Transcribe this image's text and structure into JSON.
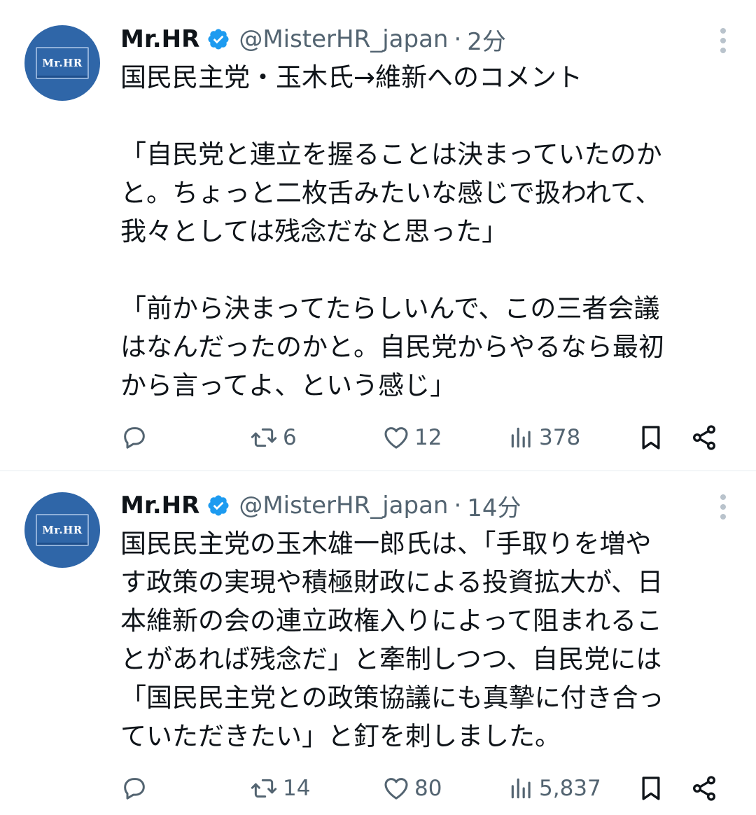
{
  "tweets": [
    {
      "author_name": "Mr.HR",
      "avatar_text": "Mr.HR",
      "handle": "@MisterHR_japan",
      "separator": "·",
      "time": "2分",
      "lines": [
        "国民民主党・玉木氏→維新へのコメント",
        "",
        "「自民党と連立を握ることは決まっていたのか",
        "と。ちょっと二枚舌みたいな感じで扱われて、",
        "我々としては残念だなと思った」",
        "",
        "「前から決まってたらしいんで、この三者会議",
        "はなんだったのかと。自民党からやるなら最初",
        "から言ってよ、という感じ」"
      ],
      "retweets": "6",
      "likes": "12",
      "views": "378"
    },
    {
      "author_name": "Mr.HR",
      "avatar_text": "Mr.HR",
      "handle": "@MisterHR_japan",
      "separator": "·",
      "time": "14分",
      "lines": [
        "国民民主党の玉木雄一郎氏は、「手取りを増や",
        "す政策の実現や積極財政による投資拡大が、日",
        "本維新の会の連立政権入りによって阻まれるこ",
        "とがあれば残念だ」と牽制しつつ、自民党には",
        "「国民民主党との政策協議にも真摯に付き合っ",
        "ていただきたい」と釘を刺しました。"
      ],
      "retweets": "14",
      "likes": "80",
      "views": "5,837"
    }
  ],
  "icons": {
    "verified": "verified-badge-icon",
    "more": "more-vertical-icon",
    "reply": "reply-icon",
    "retweet": "retweet-icon",
    "like": "heart-icon",
    "views": "views-icon",
    "bookmark": "bookmark-icon",
    "share": "share-icon"
  },
  "colors": {
    "text": "#0f1419",
    "secondary": "#536471",
    "verified": "#1d9bf0",
    "avatar_bg": "#2f66a8",
    "divider": "#e6ecf0"
  }
}
